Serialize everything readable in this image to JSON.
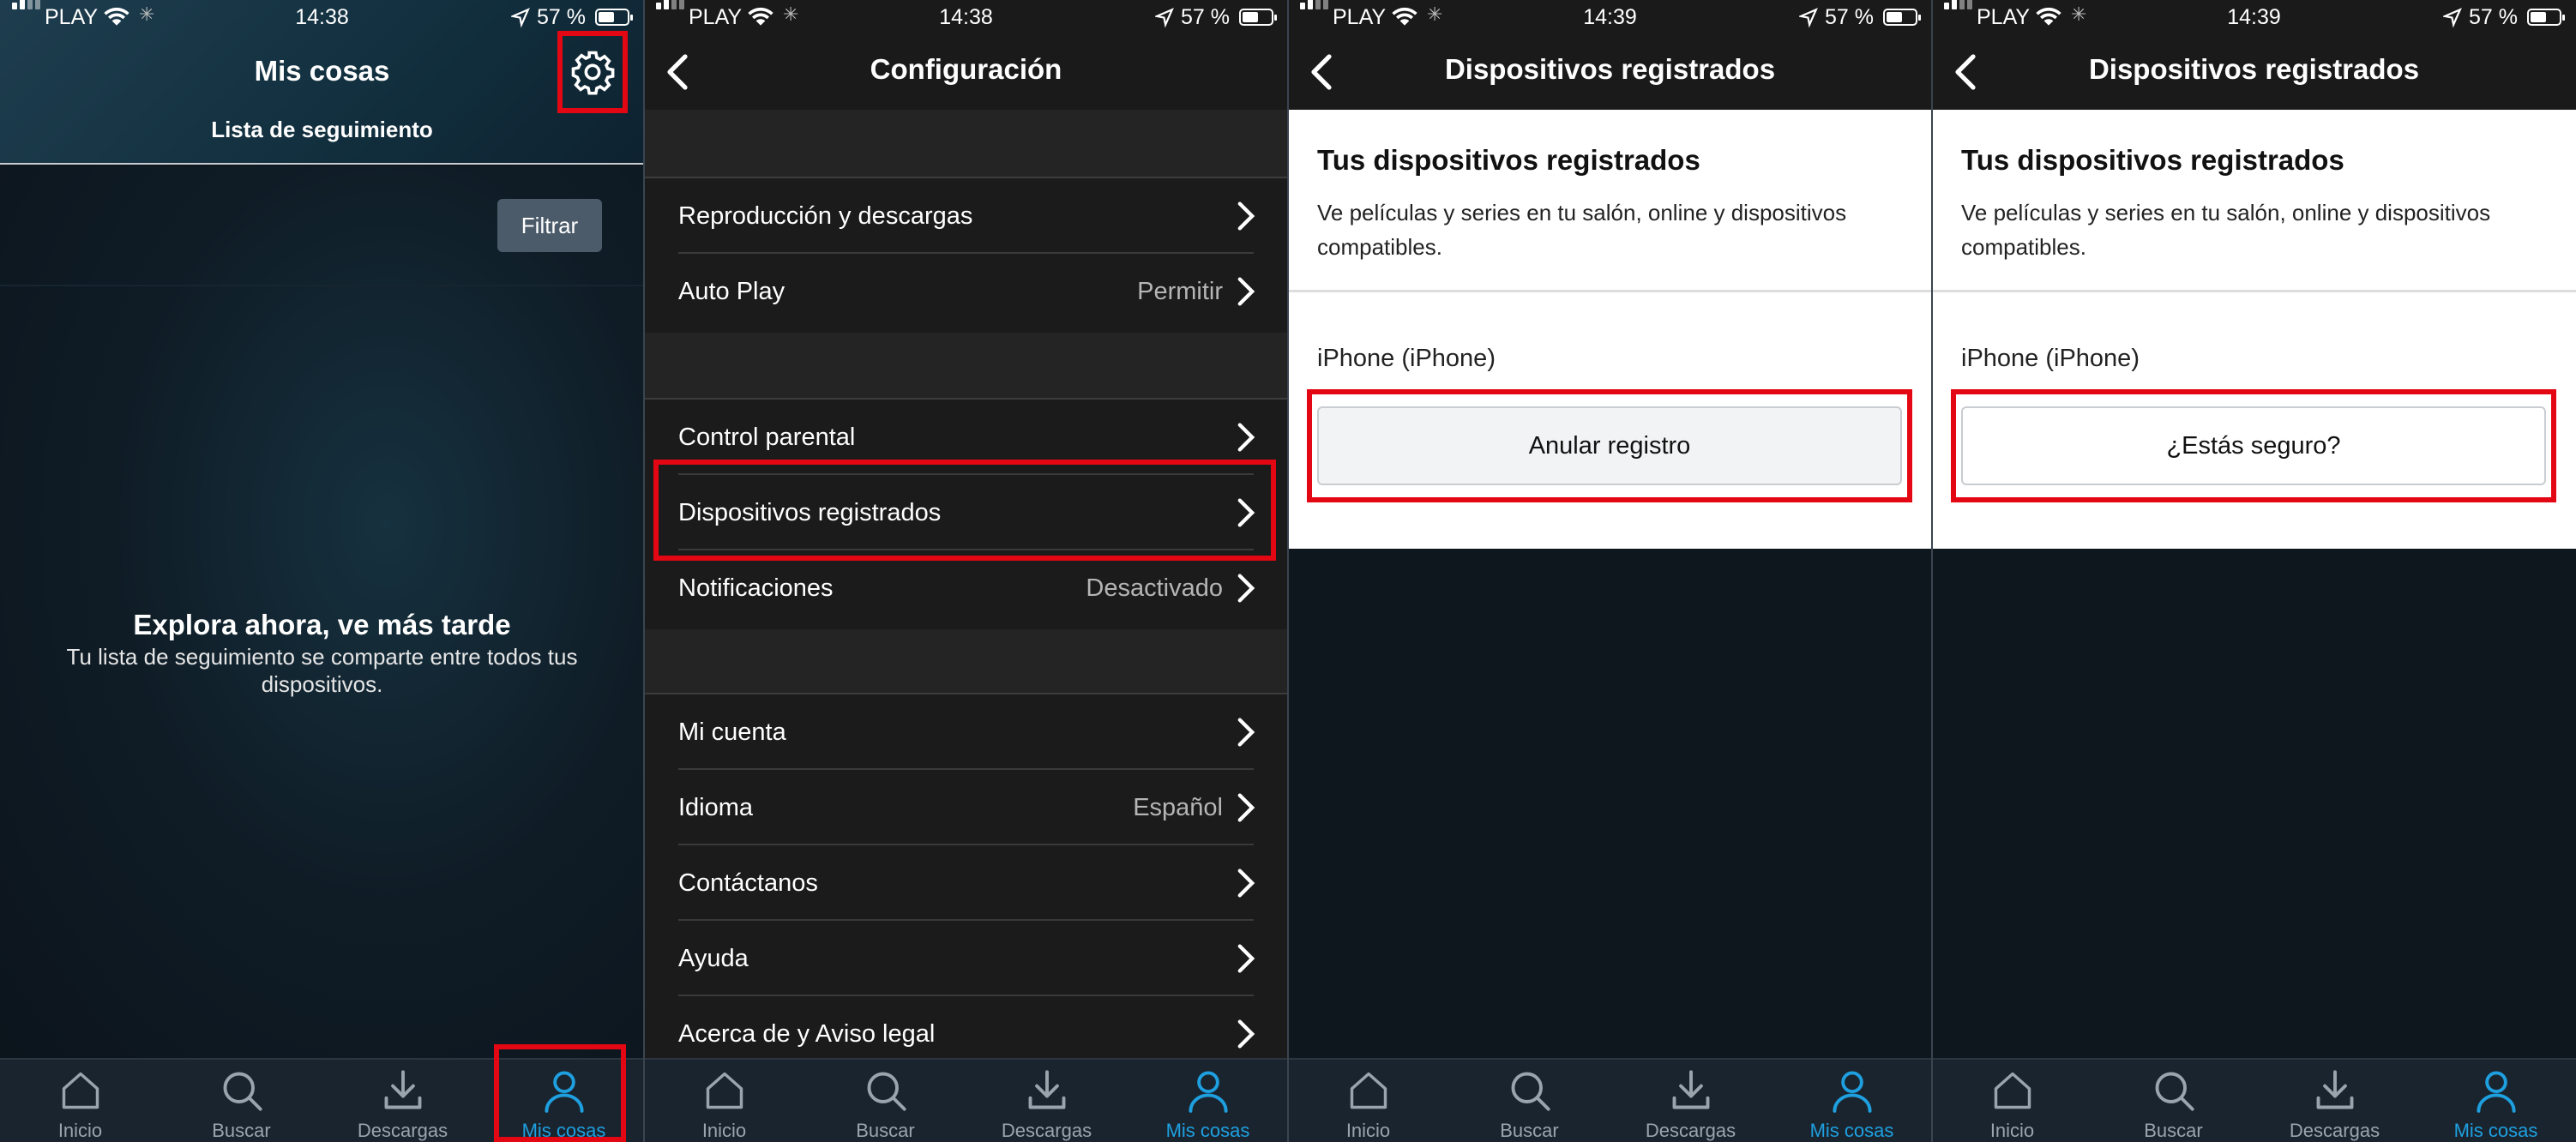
{
  "status": {
    "carrier": "PLAY",
    "battery": "57 %",
    "battery_fill": 0.57
  },
  "times": [
    "14:38",
    "14:38",
    "14:39",
    "14:39"
  ],
  "tabs": [
    {
      "label": "Inicio",
      "icon": "home-icon"
    },
    {
      "label": "Buscar",
      "icon": "search-icon"
    },
    {
      "label": "Descargas",
      "icon": "download-icon"
    },
    {
      "label": "Mis cosas",
      "icon": "profile-icon"
    }
  ],
  "mis_cosas": {
    "title": "Mis cosas",
    "subtitle": "Lista de seguimiento",
    "filter": "Filtrar",
    "empty_title": "Explora ahora, ve más tarde",
    "empty_desc": "Tu lista de seguimiento se comparte entre todos tus dispositivos."
  },
  "config": {
    "title": "Configuración",
    "rows": [
      {
        "label": "Reproducción y descargas",
        "value": ""
      },
      {
        "label": "Auto Play",
        "value": "Permitir"
      },
      {
        "label": "Control parental",
        "value": ""
      },
      {
        "label": "Dispositivos registrados",
        "value": ""
      },
      {
        "label": "Notificaciones",
        "value": "Desactivado"
      },
      {
        "label": "Mi cuenta",
        "value": ""
      },
      {
        "label": "Idioma",
        "value": "Español"
      },
      {
        "label": "Contáctanos",
        "value": ""
      },
      {
        "label": "Ayuda",
        "value": ""
      },
      {
        "label": "Acerca de y Aviso legal",
        "value": ""
      }
    ]
  },
  "devices": {
    "title": "Dispositivos registrados",
    "heading": "Tus dispositivos registrados",
    "desc": "Ve películas y series en tu salón, online y dispositivos compatibles.",
    "device": "iPhone (iPhone)",
    "deregister": "Anular registro",
    "confirm": "¿Estás seguro?"
  }
}
